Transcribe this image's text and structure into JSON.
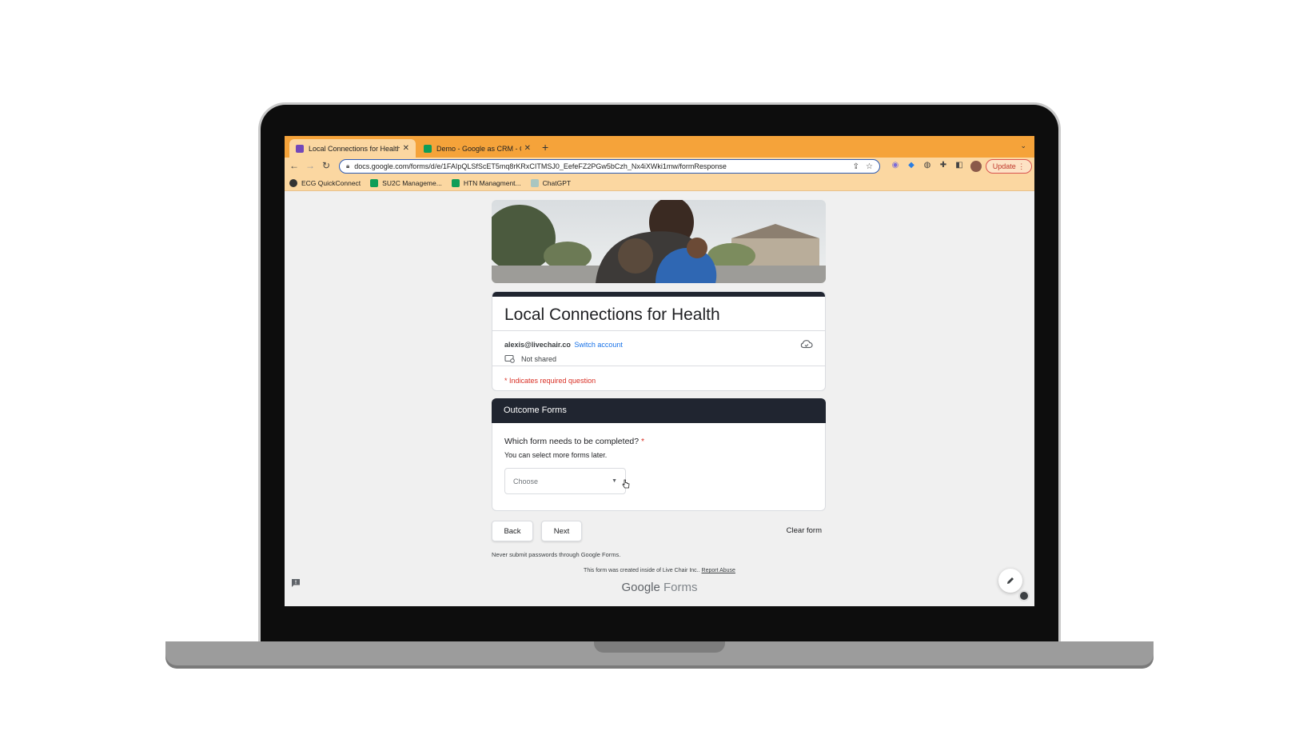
{
  "browser": {
    "tabs": [
      {
        "label": "Local Connections for Health",
        "active": true,
        "favicon_color": "#7248b9"
      },
      {
        "label": "Demo - Google as CRM - Goog",
        "active": false,
        "favicon_color": "#0f9d58"
      }
    ],
    "address": "docs.google.com/forms/d/e/1FAIpQLSfScET5mq8rKRxCITMSJ0_EefeFZ2PGw5bCzh_Nx4iXWki1mw/formResponse",
    "update_label": "Update",
    "bookmarks": [
      {
        "label": "ECG QuickConnect",
        "icon": "circle-icon"
      },
      {
        "label": "SU2C Manageme...",
        "icon": "sheets-icon"
      },
      {
        "label": "HTN Managment...",
        "icon": "sheets-icon"
      },
      {
        "label": "ChatGPT",
        "icon": "chatgpt-icon"
      }
    ],
    "colors": {
      "tabstrip": "#f5a33a",
      "toolbar": "#fbd7a1"
    }
  },
  "form": {
    "title": "Local Connections for Health",
    "account_email": "alexis@livechair.co",
    "switch_account": "Switch account",
    "not_shared": "Not shared",
    "required_note": "* Indicates required question",
    "section_title": "Outcome Forms",
    "question": "Which form needs to be completed?",
    "required_marker": "*",
    "help_text": "You can select more forms later.",
    "dropdown_placeholder": "Choose",
    "back_label": "Back",
    "next_label": "Next",
    "clear_label": "Clear form",
    "never_submit": "Never submit passwords through Google Forms.",
    "created_note": "This form was created inside of Live Chair Inc..",
    "report_abuse": "Report Abuse",
    "logo_google": "Google",
    "logo_forms": "Forms",
    "colors": {
      "header": "#202530",
      "required": "#d93025",
      "link": "#1a73e8"
    }
  }
}
